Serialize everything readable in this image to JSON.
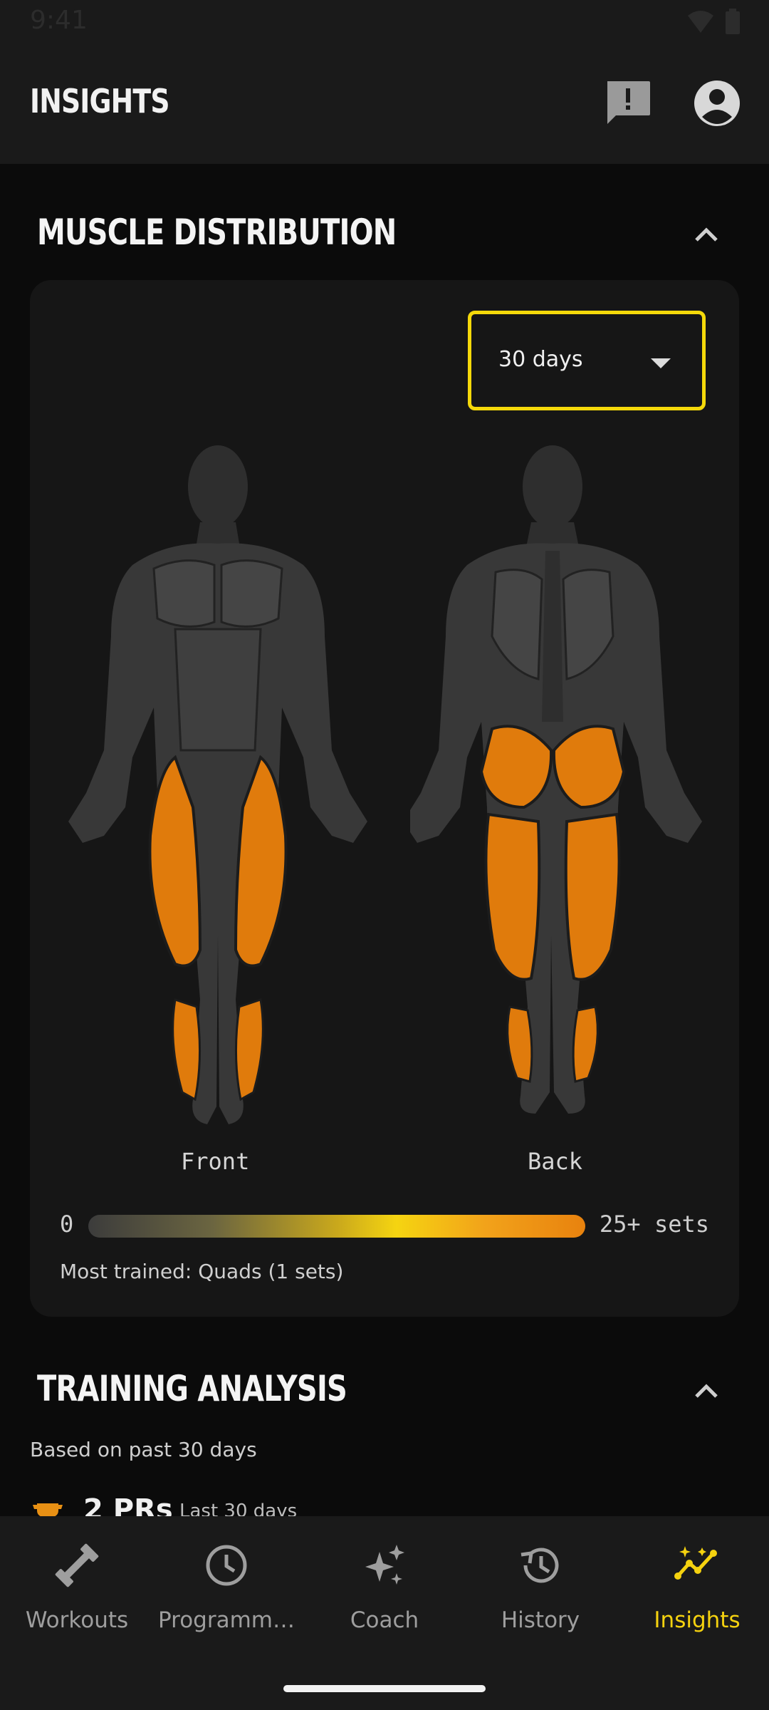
{
  "status_bar": {
    "time": "9:41"
  },
  "header": {
    "title": "INSIGHTS",
    "feedback_icon": "feedback-icon",
    "account_icon": "account-circle-icon"
  },
  "muscle_distribution": {
    "title": "MUSCLE DISTRIBUTION",
    "period_selected": "30 days",
    "front_label": "Front",
    "back_label": "Back",
    "scale_min": "0",
    "scale_max": "25+ sets",
    "most_trained": "Most trained: Quads (1 sets)",
    "highlight_color": "#e07b0c",
    "base_color": "#3a3a3a"
  },
  "training_analysis": {
    "title": "TRAINING ANALYSIS",
    "subtitle": "Based on past 30 days",
    "pr_count": "2 PRs",
    "pr_period": "Last 30 days"
  },
  "nav": {
    "items": [
      {
        "label": "Workouts",
        "icon": "dumbbell-icon"
      },
      {
        "label": "Programm…",
        "icon": "clock-icon"
      },
      {
        "label": "Coach",
        "icon": "sparkle-icon"
      },
      {
        "label": "History",
        "icon": "history-icon"
      },
      {
        "label": "Insights",
        "icon": "trend-icon"
      }
    ],
    "active_color": "#f5d20f",
    "inactive_color": "#9e9e9e"
  }
}
